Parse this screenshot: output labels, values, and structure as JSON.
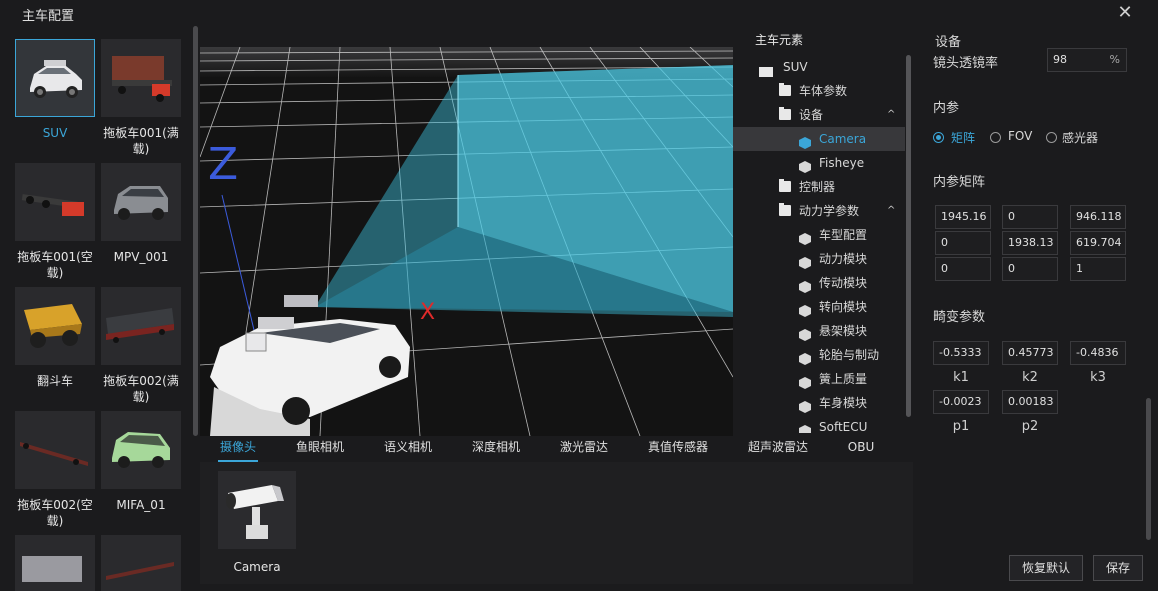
{
  "window": {
    "title": "主车配置"
  },
  "vehicles": [
    {
      "label": "SUV"
    },
    {
      "label": "拖板车001(满载)"
    },
    {
      "label": "拖板车001(空载)"
    },
    {
      "label": "MPV_001"
    },
    {
      "label": "翻斗车"
    },
    {
      "label": "拖板车002(满载)"
    },
    {
      "label": "拖板车002(空载)"
    },
    {
      "label": "MIFA_01"
    }
  ],
  "viewport": {
    "axis_z": "Z",
    "axis_x": "X"
  },
  "tree": {
    "title": "主车元素",
    "items": [
      {
        "label": "SUV"
      },
      {
        "label": "车体参数"
      },
      {
        "label": "设备"
      },
      {
        "label": "Camera"
      },
      {
        "label": "Fisheye"
      },
      {
        "label": "控制器"
      },
      {
        "label": "动力学参数"
      },
      {
        "label": "车型配置"
      },
      {
        "label": "动力模块"
      },
      {
        "label": "传动模块"
      },
      {
        "label": "转向模块"
      },
      {
        "label": "悬架模块"
      },
      {
        "label": "轮胎与制动"
      },
      {
        "label": "簧上质量"
      },
      {
        "label": "车身模块"
      },
      {
        "label": "SoftECU"
      }
    ]
  },
  "tabs": [
    {
      "label": "摄像头"
    },
    {
      "label": "鱼眼相机"
    },
    {
      "label": "语义相机"
    },
    {
      "label": "深度相机"
    },
    {
      "label": "激光雷达"
    },
    {
      "label": "真值传感器"
    },
    {
      "label": "超声波雷达"
    },
    {
      "label": "OBU"
    }
  ],
  "sensors": [
    {
      "label": "Camera"
    }
  ],
  "props": {
    "section": "设备",
    "lens_label": "镜头透镜率",
    "lens_value": "98",
    "lens_unit": "%",
    "intrinsic_title": "内参",
    "radio_options": [
      "矩阵",
      "FOV",
      "感光器"
    ],
    "matrix_title": "内参矩阵",
    "matrix": [
      "1945.16",
      "0",
      "946.118",
      "0",
      "1938.13",
      "619.704",
      "0",
      "0",
      "1"
    ],
    "distortion_title": "畸变参数",
    "distortion": [
      {
        "value": "-0.5333",
        "label": "k1"
      },
      {
        "value": "0.45773",
        "label": "k2"
      },
      {
        "value": "-0.4836",
        "label": "k3"
      },
      {
        "value": "-0.0023",
        "label": "p1"
      },
      {
        "value": "0.00183",
        "label": "p2"
      }
    ],
    "reset_label": "恢复默认",
    "save_label": "保存"
  },
  "colors": {
    "accent": "#3ba6d8",
    "frustum": "#3fc4e0"
  }
}
